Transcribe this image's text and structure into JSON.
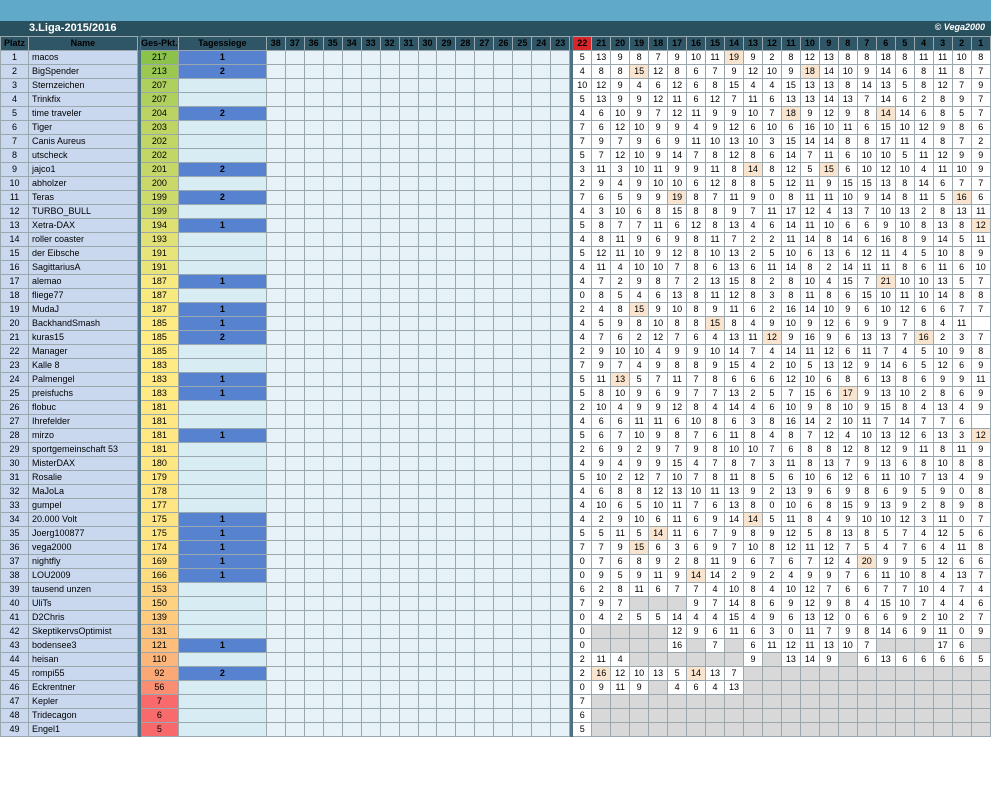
{
  "sheet": {
    "title": "3.Liga-2015/2016",
    "copyright": "© Vega2000",
    "headers": {
      "platz": "Platz",
      "name": "Name",
      "ges": "Ges-Pkt.",
      "tage": "Tagessiege"
    },
    "empty_rounds": [
      "38",
      "37",
      "36",
      "35",
      "34",
      "33",
      "32",
      "31",
      "30",
      "29",
      "28",
      "27",
      "26",
      "25",
      "24",
      "23"
    ],
    "rounds": [
      "22",
      "21",
      "20",
      "19",
      "18",
      "17",
      "16",
      "15",
      "14",
      "13",
      "12",
      "11",
      "10",
      "9",
      "8",
      "7",
      "6",
      "5",
      "4",
      "3",
      "2",
      "1"
    ],
    "current_round": "22"
  },
  "colors": {
    "gradient_top": "#8bc34a",
    "gradient_mid": "#ffeb84",
    "gradient_low": "#f8696b",
    "tagessiege": "#5682cf",
    "highlight": "#f9e4cf",
    "current": "#d9262a"
  },
  "rows": [
    {
      "p": "1",
      "n": "macos",
      "g": "217",
      "t": "1",
      "s": "5 13 9 8 7 9 10 11 19 9 2 8 12 13 8 8 18 8 11 11 10 8"
    },
    {
      "p": "2",
      "n": "BigSpender",
      "g": "213",
      "t": "2",
      "s": "4 8 8 15 12 8 6 7 9 12 10 9 18 14 10 9 14 6 8 11 8 7"
    },
    {
      "p": "3",
      "n": "Sternzeichen",
      "g": "207",
      "t": "",
      "s": "10 12 9 4 6 12 6 8 15 4 4 15 13 13 8 14 13 5 8 12 7 9"
    },
    {
      "p": "4",
      "n": "Trinkfix",
      "g": "207",
      "t": "",
      "s": "5 13 9 9 12 11 6 12 7 11 6 13 13 14 13 7 14 6 2 8 9 7"
    },
    {
      "p": "5",
      "n": "time traveler",
      "g": "204",
      "t": "2",
      "s": "4 6 10 9 7 12 11 9 9 10 7 18 9 12 9 8 14 14 6 8 5 7"
    },
    {
      "p": "6",
      "n": "Tiger",
      "g": "203",
      "t": "",
      "s": "7 6 12 10 9 9 4 9 12 6 10 6 16 10 11 6 15 10 12 9 8 6"
    },
    {
      "p": "7",
      "n": "Canis Aureus",
      "g": "202",
      "t": "",
      "s": "7 9 7 9 6 9 11 10 13 10 3 15 14 14 8 8 17 11 4 8 7 2"
    },
    {
      "p": "8",
      "n": "utscheck",
      "g": "202",
      "t": "",
      "s": "5 7 12 10 9 14 7 8 12 8 6 14 7 11 6 10 10 5 11 12 9 9"
    },
    {
      "p": "9",
      "n": "jajco1",
      "g": "201",
      "t": "2",
      "s": "3 11 3 10 11 9 9 11 8 14 8 12 5 15 6 10 12 10 4 11 10 9"
    },
    {
      "p": "10",
      "n": "abholzer",
      "g": "200",
      "t": "",
      "s": "2 9 4 9 10 10 6 12 8 8 5 12 11 9 15 15 13 8 14 6 7 7"
    },
    {
      "p": "11",
      "n": "Teras",
      "g": "199",
      "t": "2",
      "s": "7 6 5 9 9 19 8 7 11 9 0 8 11 11 10 9 14 8 11 5 16 6"
    },
    {
      "p": "12",
      "n": "TURBO_BULL",
      "g": "199",
      "t": "",
      "s": "4 3 10 6 8 15 8 8 9 7 11 17 12 4 13 7 10 13 2 8 13 11"
    },
    {
      "p": "13",
      "n": "Xetra-DAX",
      "g": "194",
      "t": "1",
      "s": "5 8 7 7 11 6 12 8 13 4 6 14 11 10 6 6 9 10 8 13 8 12"
    },
    {
      "p": "14",
      "n": "roller coaster",
      "g": "193",
      "t": "",
      "s": "4 8 11 9 6 9 8 11 7 2 2 11 14 8 14 6 16 8 9 14 5 11"
    },
    {
      "p": "15",
      "n": "der Eibsche",
      "g": "191",
      "t": "",
      "s": "5 12 11 10 9 12 8 10 13 2 5 10 6 13 6 12 11 4 5 10 8 9"
    },
    {
      "p": "16",
      "n": "SagittariusA",
      "g": "191",
      "t": "",
      "s": "4 11 4 10 10 7 8 6 13 6 11 14 8 2 14 11 11 8 6 11 6 10"
    },
    {
      "p": "17",
      "n": "alemao",
      "g": "187",
      "t": "1",
      "s": "4 7 2 9 8 7 2 13 15 8 2 8 10 4 15 7 21 10 10 13 5 7"
    },
    {
      "p": "18",
      "n": "fliege77",
      "g": "187",
      "t": "",
      "s": "0 8 5 4 6 13 8 11 12 8 3 8 11 8 6 15 10 11 10 14 8 8"
    },
    {
      "p": "19",
      "n": "MudaJ",
      "g": "187",
      "t": "1",
      "s": "2 4 8 15 9 10 8 9 11 6 2 16 14 10 9 6 10 12 6 6 7 7"
    },
    {
      "p": "20",
      "n": "BackhandSmash",
      "g": "185",
      "t": "1",
      "s": "4 5 9 8 10 8 8 15 8 4 9 10 9 12 6 9 9 7 8 4 11"
    },
    {
      "p": "21",
      "n": "kuras15",
      "g": "185",
      "t": "2",
      "s": "4 7 6 2 12 7 6 4 13 11 12 9 16 9 6 13 13 7 16 2 3 7"
    },
    {
      "p": "22",
      "n": "Manager",
      "g": "185",
      "t": "",
      "s": "2 9 10 10 4 9 9 10 14 7 4 14 11 12 6 11 7 4 5 10 9 8"
    },
    {
      "p": "23",
      "n": "Kalle 8",
      "g": "183",
      "t": "",
      "s": "7 9 7 4 9 8 8 9 15 4 2 10 5 13 12 9 14 6 5 12 6 9"
    },
    {
      "p": "24",
      "n": "Palmengel",
      "g": "183",
      "t": "1",
      "s": "5 11 13 5 7 11 7 8 6 6 6 12 10 6 8 6 13 8 6 9 9 11"
    },
    {
      "p": "25",
      "n": "preisfuchs",
      "g": "183",
      "t": "1",
      "s": "5 8 10 9 6 9 7 7 13 2 5 7 15 6 17 9 13 10 2 8 6 9"
    },
    {
      "p": "26",
      "n": "flobuc",
      "g": "181",
      "t": "",
      "s": "2 10 4 9 9 12 8 4 14 4 6 10 9 8 10 9 15 8 4 13 4 9"
    },
    {
      "p": "27",
      "n": "Ihrefelder",
      "g": "181",
      "t": "",
      "s": "4 6 6 11 11 6 10 8 6 3 8 16 14 2 10 11 7 14 7 7 6"
    },
    {
      "p": "28",
      "n": "mirzo",
      "g": "181",
      "t": "1",
      "s": "5 6 7 10 9 8 7 6 11 8 4 8 7 12 4 10 13 12 6 13 3 12"
    },
    {
      "p": "29",
      "n": "sportgemeinschaft 53",
      "g": "181",
      "t": "",
      "s": "2 6 9 2 9 7 9 8 10 10 7 6 8 8 12 8 12 9 11 8 11 9"
    },
    {
      "p": "30",
      "n": "MisterDAX",
      "g": "180",
      "t": "",
      "s": "4 9 4 9 9 15 4 7 8 7 3 11 8 13 7 9 13 6 8 10 8 8"
    },
    {
      "p": "31",
      "n": "Rosalie",
      "g": "179",
      "t": "",
      "s": "5 10 2 12 7 10 7 8 11 8 5 6 10 6 12 6 11 10 7 13 4 9"
    },
    {
      "p": "32",
      "n": "MaJoLa",
      "g": "178",
      "t": "",
      "s": "4 6 8 8 12 13 10 11 13 9 2 13 9 6 9 8 6 9 5 9 0 8"
    },
    {
      "p": "33",
      "n": "gumpel",
      "g": "177",
      "t": "",
      "s": "4 10 6 5 10 11 7 6 13 8 0 10 6 8 15 9 13 9 2 8 9 8"
    },
    {
      "p": "34",
      "n": "20.000 Volt",
      "g": "175",
      "t": "1",
      "s": "4 2 9 10 6 11 6 9 14 14 5 11 8 4 9 10 10 12 3 11 0 7"
    },
    {
      "p": "35",
      "n": "Joerg100877",
      "g": "175",
      "t": "1",
      "s": "5 5 11 5 14 11 6 7 9 8 9 12 5 8 13 8 5 7 4 12 5 6"
    },
    {
      "p": "36",
      "n": "vega2000",
      "g": "174",
      "t": "1",
      "s": "7 7 9 15 6 3 6 9 7 10 8 12 11 12 7 5 4 7 6 4 11 8"
    },
    {
      "p": "37",
      "n": "nightfly",
      "g": "169",
      "t": "1",
      "s": "0 7 6 8 9 2 8 11 9 6 7 6 7 12 4 20 9 9 5 12 6 6"
    },
    {
      "p": "38",
      "n": "LOU2009",
      "g": "166",
      "t": "1",
      "s": "0 9 5 9 11 9 14 14 2 9 2 4 9 9 7 6 11 10 8 4 13 7 8"
    },
    {
      "p": "39",
      "n": "tausend unzen",
      "g": "153",
      "t": "",
      "s": "6 2 8 11 6 7 7 4 10 8 4 10 12 7 6 6 7 7 10 4 7 4"
    },
    {
      "p": "40",
      "n": "UliTs",
      "g": "150",
      "t": "",
      "s": "7 9 7 _ _ _ 9 7 14 8 6 9 12 9 8 4 15 10 7 4 4 6"
    },
    {
      "p": "41",
      "n": "D2Chris",
      "g": "139",
      "t": "",
      "s": "0 4 2 5 5 14 4 4 15 4 9 6 13 12 0 6 6 9 2 10 2 7"
    },
    {
      "p": "42",
      "n": "SkeptikervsOptimist",
      "g": "131",
      "t": "",
      "s": "0 _ _ _ _ 12 9 6 11 6 3 0 11 7 9 8 14 6 9 11 0 9"
    },
    {
      "p": "43",
      "n": "bodensee3",
      "g": "121",
      "t": "1",
      "s": "0 _ _ _ _ 16 _ 7 _ 6 11 12 11 13 10 7 _ _ _ 17 6 _"
    },
    {
      "p": "44",
      "n": "heisan",
      "g": "110",
      "t": "",
      "s": "2 11 4 _ _ _ _ _ _ 9 _ 13 14 9 _ 6 13 6 6 6 6 5"
    },
    {
      "p": "45",
      "n": "rompi55",
      "g": "92",
      "t": "2",
      "s": "2 16 12 10 13 5 14 13 7 _ _ _ _ _ _ _ _ _ _ _ _ _"
    },
    {
      "p": "46",
      "n": "Eckrentner",
      "g": "56",
      "t": "",
      "s": "0 9 11 9 _ 4 6 4 13 _ _ _ _ _ _ _ _ _ _ _ _ _"
    },
    {
      "p": "47",
      "n": "Kepler",
      "g": "7",
      "t": "",
      "s": "7 _ _ _ _ _ _ _ _ _ _ _ _ _ _ _ _ _ _ _ _ _"
    },
    {
      "p": "48",
      "n": "Tridecagon",
      "g": "6",
      "t": "",
      "s": "6 _ _ _ _ _ _ _ _ _ _ _ _ _ _ _ _ _ _ _ _ _"
    },
    {
      "p": "49",
      "n": "Engel1",
      "g": "5",
      "t": "",
      "s": "5 _ _ _ _ _ _ _ _ _ _ _ _ _ _ _ _ _ _ _ _ _"
    }
  ],
  "highlights": {
    "1": [
      8
    ],
    "2": [
      3,
      12
    ],
    "5": [
      11,
      16
    ],
    "9": [
      9,
      13
    ],
    "11": [
      5,
      20
    ],
    "13": [
      21
    ],
    "17": [
      16
    ],
    "19": [
      3
    ],
    "20": [
      7
    ],
    "21": [
      10,
      18
    ],
    "24": [
      2
    ],
    "25": [
      14
    ],
    "28": [
      21
    ],
    "34": [
      9
    ],
    "35": [
      4
    ],
    "36": [
      3
    ],
    "37": [
      15
    ],
    "38": [
      6
    ],
    "45": [
      1,
      6
    ]
  }
}
